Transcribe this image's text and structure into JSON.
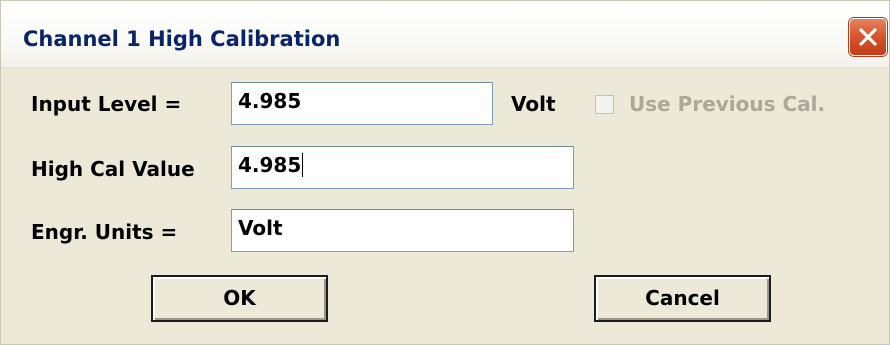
{
  "window": {
    "title": "Channel 1 High Calibration"
  },
  "form": {
    "input_level_label": "Input Level =",
    "input_level_value": "4.985",
    "input_level_unit": "Volt",
    "use_previous_label": "Use Previous Cal.",
    "use_previous_checked": false,
    "high_cal_label": "High Cal Value",
    "high_cal_value": "4.985",
    "engr_units_label": "Engr. Units =",
    "engr_units_value": "Volt"
  },
  "buttons": {
    "ok_label": "OK",
    "cancel_label": "Cancel"
  },
  "icons": {
    "close": "close-icon"
  },
  "colors": {
    "title_text": "#0a246a",
    "dialog_bg": "#ece9d8",
    "close_button": "#d4542d",
    "disabled_text": "#aca899"
  }
}
